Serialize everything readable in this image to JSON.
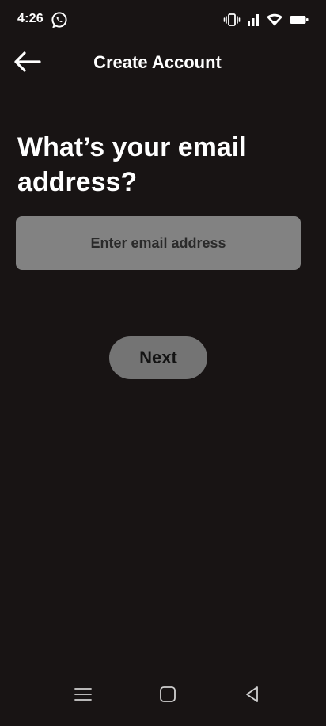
{
  "status_bar": {
    "time": "4:26",
    "icons": [
      "whatsapp-icon",
      "vibrate-icon",
      "signal-icon",
      "wifi-icon",
      "battery-icon"
    ]
  },
  "app_bar": {
    "title": "Create Account",
    "back_icon": "arrow-left-icon"
  },
  "content": {
    "question": "What’s your email address?",
    "email_placeholder": "Enter email address",
    "email_value": "",
    "next_label": "Next"
  },
  "nav_bar": {
    "icons": [
      "menu-icon",
      "home-square-icon",
      "back-triangle-icon"
    ]
  },
  "colors": {
    "background": "#181414",
    "text": "#ffffff",
    "input_bg": "#828282",
    "button_bg": "#747474",
    "button_text": "#141414"
  }
}
